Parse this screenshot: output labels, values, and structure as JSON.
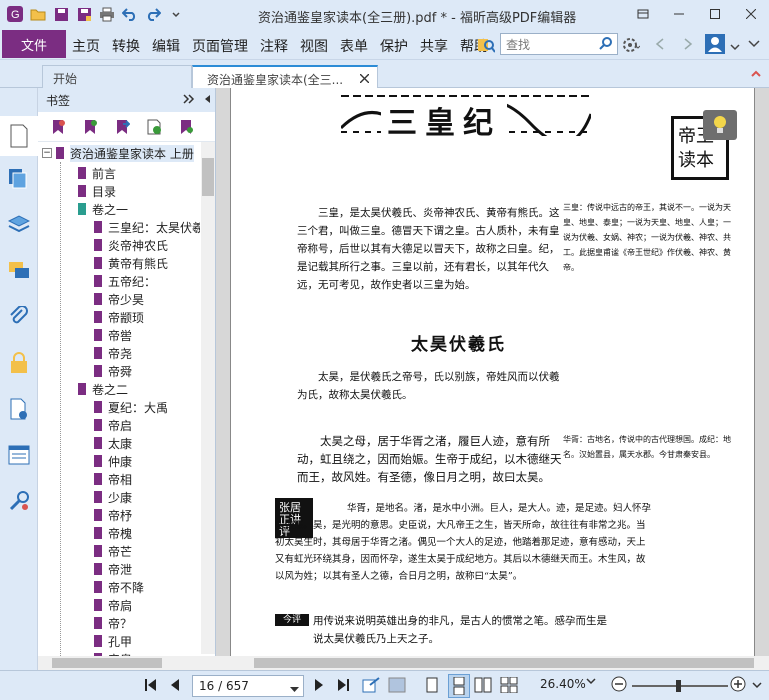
{
  "window": {
    "title": "资治通鉴皇家读本(全三册).pdf * - 福昕高级PDF编辑器"
  },
  "colors": {
    "accent": "#7b2d82",
    "chrome": "#dde9f7",
    "active_tab": "#2d8cd6",
    "close_icon": "#d9534f"
  },
  "menu": {
    "file": "文件",
    "items": [
      "主页",
      "转换",
      "编辑",
      "页面管理",
      "注释",
      "视图",
      "表单",
      "保护",
      "共享",
      "帮助"
    ]
  },
  "search": {
    "placeholder": "查找"
  },
  "tabs": {
    "start": "开始",
    "doc": "资治通鉴皇家读本(全三..."
  },
  "bookmarks": {
    "header": "书签",
    "root": "资治通鉴皇家读本 上册",
    "items": [
      {
        "label": "前言",
        "indent": 1
      },
      {
        "label": "目录",
        "indent": 1
      },
      {
        "label": "卷之一",
        "indent": 1
      },
      {
        "label": "三皇纪：太昊伏羲",
        "indent": 2
      },
      {
        "label": "炎帝神农氏",
        "indent": 2
      },
      {
        "label": "黄帝有熊氏",
        "indent": 2
      },
      {
        "label": "五帝纪：",
        "indent": 2
      },
      {
        "label": "帝少昊",
        "indent": 2
      },
      {
        "label": "帝颛顼",
        "indent": 2
      },
      {
        "label": "帝喾",
        "indent": 2
      },
      {
        "label": "帝尧",
        "indent": 2
      },
      {
        "label": "帝舜",
        "indent": 2
      },
      {
        "label": "卷之二",
        "indent": 1
      },
      {
        "label": "夏纪：大禹",
        "indent": 2
      },
      {
        "label": "帝启",
        "indent": 2
      },
      {
        "label": "太康",
        "indent": 2
      },
      {
        "label": "仲康",
        "indent": 2
      },
      {
        "label": "帝相",
        "indent": 2
      },
      {
        "label": "少康",
        "indent": 2
      },
      {
        "label": "帝杼",
        "indent": 2
      },
      {
        "label": "帝槐",
        "indent": 2
      },
      {
        "label": "帝芒",
        "indent": 2
      },
      {
        "label": "帝泄",
        "indent": 2
      },
      {
        "label": "帝不降",
        "indent": 2
      },
      {
        "label": "帝扃",
        "indent": 2
      },
      {
        "label": "帝？",
        "indent": 2
      },
      {
        "label": "孔甲",
        "indent": 2
      },
      {
        "label": "帝皋",
        "indent": 2
      }
    ]
  },
  "page": {
    "header": "三皇纪",
    "seal": "帝王读本",
    "p1": "三皇，是太昊伏羲氏、炎帝神农氏、黄帝有熊氏。这三个君，叫做三皇。德冒天下谓之皇。古人质朴，未有皇帝称号，后世以其有大德足以冒天下，故称之曰皇。纪，是记载其所行之事。三皇以前，还有君长，以其年代久远，无可考见，故作史者以三皇为始。",
    "note1": "三皇：传说中远古的帝王，其说不一。一说为天皇、地皇、泰皇；一说为天皇、地皇、人皇；一说为伏羲、女娲、神农；一说为伏羲、神农、共工。此据皇甫谧《帝王世纪》作伏羲、神农、黄帝。",
    "title": "太昊伏羲氏",
    "p2": "太昊，是伏羲氏之帝号，氏以别族，帝姓风而以伏羲为氏，故称太昊伏羲氏。",
    "p3": "太昊之母，居于华胥之渚，履巨人迹，意有所动，虹且绕之，因而始娠。生帝于成纪，以木德继天而王，故风姓。有圣德，像日月之明，故曰太昊。",
    "note2": "华胥：古地名，传说中的古代理想国。成纪：地名。汉始置县，属天水郡。今甘肃秦安县。",
    "commentary_tag": "张居正讲评",
    "p4": "华胥，是地名。渚，是水中小洲。巨人，是大人。迹，是足迹。妇人怀孕叫做娠。昊，是光明的意思。史臣说，大凡帝王之生，皆天所命，故往往有非常之兆。当初太昊生时，其母居于华胥之渚。偶见一个大人的足迹，他踏着那足迹，意有感动，天上又有虹光环绕其身，因而怀孕，遂生太昊于成纪地方。其后以木德继天而王。木生风，故以风为姓；以其有圣人之德，合日月之明，故称曰“太昊”。",
    "modern_tag": "今评",
    "p5": "用传说来说明英雄出身的非凡，是古人的惯常之笔。感孕而生是说太昊伏羲氏乃上天之子。"
  },
  "status": {
    "page": "16 / 657",
    "zoom": "26.40%"
  }
}
